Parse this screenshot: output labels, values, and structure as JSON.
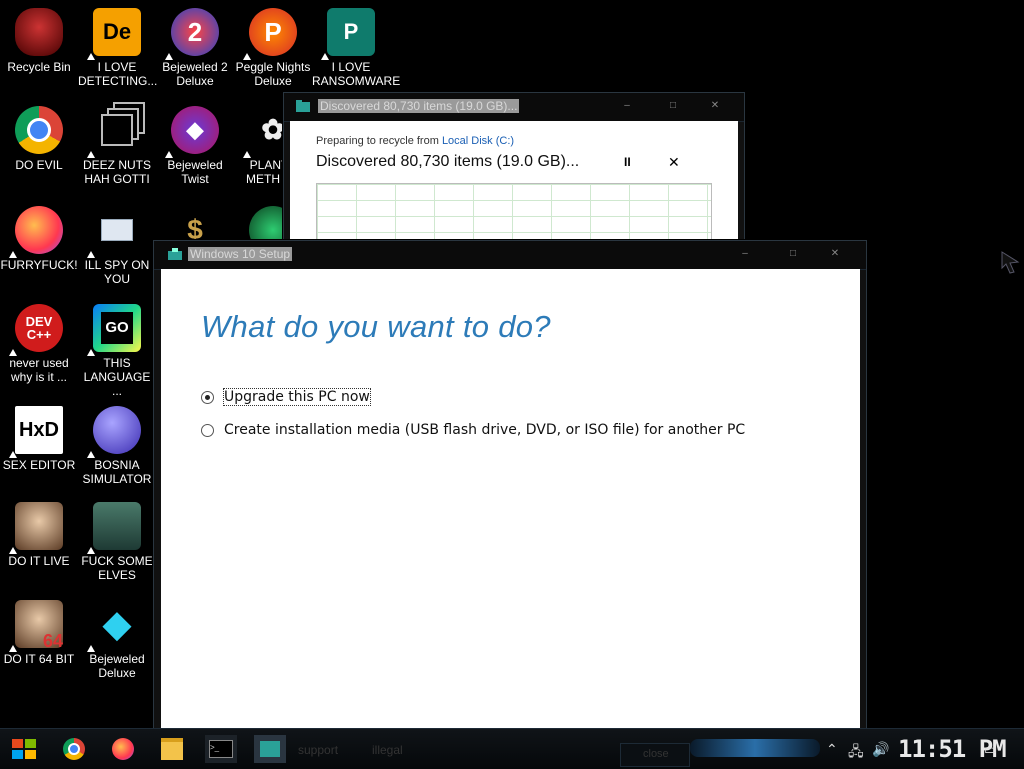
{
  "desktop": {
    "icons": [
      {
        "label": "Recycle Bin",
        "icon": "recycle-bin-icon",
        "col": 0,
        "row": 0
      },
      {
        "label": "I LOVE DETECTING...",
        "icon": "detect-it-easy-icon",
        "col": 1,
        "row": 0
      },
      {
        "label": "Bejeweled 2 Deluxe",
        "icon": "bejeweled-2-icon",
        "col": 2,
        "row": 0
      },
      {
        "label": "Peggle Nights Deluxe",
        "icon": "peggle-icon",
        "col": 3,
        "row": 0
      },
      {
        "label": "I LOVE RANSOMWARE",
        "icon": "publisher-icon",
        "col": 4,
        "row": 0
      },
      {
        "label": "DO EVIL",
        "icon": "chrome-icon",
        "col": 0,
        "row": 1
      },
      {
        "label": "DEEZ NUTS HAH GOTTI",
        "icon": "copy-icon",
        "col": 1,
        "row": 1
      },
      {
        "label": "Bejeweled Twist",
        "icon": "bejeweled-twist-icon",
        "col": 2,
        "row": 1
      },
      {
        "label": "PLANTS METH US",
        "icon": "plants-icon",
        "col": 3,
        "row": 1
      },
      {
        "label": "FURRYFUCK!",
        "icon": "firefox-icon",
        "col": 0,
        "row": 2
      },
      {
        "label": "ILL SPY ON YOU",
        "icon": "network-icon",
        "col": 1,
        "row": 2
      },
      {
        "label": "never used why is it ...",
        "icon": "devcpp-icon",
        "col": 0,
        "row": 3
      },
      {
        "label": "THIS LANGUAGE ...",
        "icon": "go-icon",
        "col": 1,
        "row": 3
      },
      {
        "label": "SEX EDITOR",
        "icon": "hxd-icon",
        "col": 0,
        "row": 4
      },
      {
        "label": "BOSNIA SIMULATOR",
        "icon": "mine-icon",
        "col": 1,
        "row": 4
      },
      {
        "label": "DO IT LIVE",
        "icon": "portrait-icon",
        "col": 0,
        "row": 5
      },
      {
        "label": "FUCK SOME ELVES",
        "icon": "elf-icon",
        "col": 1,
        "row": 5
      },
      {
        "label": "DO IT 64 BIT",
        "icon": "portrait-64-icon",
        "col": 0,
        "row": 6
      },
      {
        "label": "Bejeweled Deluxe",
        "icon": "diamond-icon",
        "col": 1,
        "row": 6
      }
    ]
  },
  "copy_dialog": {
    "title": "Discovered 80,730 items (19.0 GB)...",
    "subtitle_prefix": "Preparing to recycle from ",
    "subtitle_link": "Local Disk (C:)",
    "status": "Discovered 80,730 items (19.0 GB)...",
    "pause_label": "II",
    "close_label": "✕"
  },
  "setup_dialog": {
    "title": "Windows 10 Setup",
    "heading": "What do you want to do?",
    "options": [
      {
        "label": "Upgrade this PC now",
        "selected": true
      },
      {
        "label": "Create installation media (USB flash drive, DVD, or ISO file) for another PC",
        "selected": false
      }
    ]
  },
  "window_buttons": {
    "minimize": "–",
    "maximize": "□",
    "close": "✕"
  },
  "taskbar": {
    "clock": "11:51 PM",
    "background_labels": [
      "support",
      "illegal",
      "close"
    ]
  }
}
